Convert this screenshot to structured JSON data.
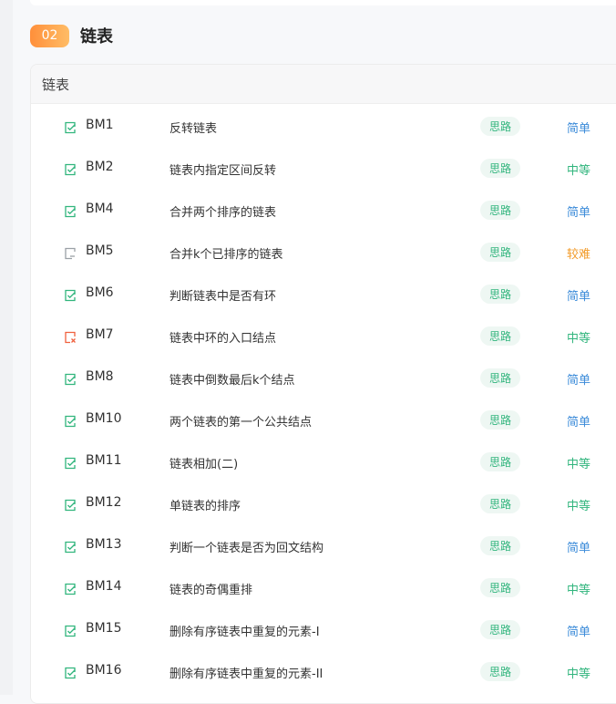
{
  "section": {
    "badge": "02",
    "title": "链表"
  },
  "card": {
    "header": "链表"
  },
  "problems": [
    {
      "code": "BM1",
      "title": "反转链表",
      "tag": "思路",
      "difficulty": "简单",
      "status": "done"
    },
    {
      "code": "BM2",
      "title": "链表内指定区间反转",
      "tag": "思路",
      "difficulty": "中等",
      "status": "done"
    },
    {
      "code": "BM4",
      "title": "合并两个排序的链表",
      "tag": "思路",
      "difficulty": "简单",
      "status": "done"
    },
    {
      "code": "BM5",
      "title": "合并k个已排序的链表",
      "tag": "思路",
      "difficulty": "较难",
      "status": "todo"
    },
    {
      "code": "BM6",
      "title": "判断链表中是否有环",
      "tag": "思路",
      "difficulty": "简单",
      "status": "done"
    },
    {
      "code": "BM7",
      "title": "链表中环的入口结点",
      "tag": "思路",
      "difficulty": "中等",
      "status": "wrong"
    },
    {
      "code": "BM8",
      "title": "链表中倒数最后k个结点",
      "tag": "思路",
      "difficulty": "简单",
      "status": "done"
    },
    {
      "code": "BM10",
      "title": "两个链表的第一个公共结点",
      "tag": "思路",
      "difficulty": "简单",
      "status": "done"
    },
    {
      "code": "BM11",
      "title": "链表相加(二)",
      "tag": "思路",
      "difficulty": "中等",
      "status": "done"
    },
    {
      "code": "BM12",
      "title": "单链表的排序",
      "tag": "思路",
      "difficulty": "中等",
      "status": "done"
    },
    {
      "code": "BM13",
      "title": "判断一个链表是否为回文结构",
      "tag": "思路",
      "difficulty": "简单",
      "status": "done"
    },
    {
      "code": "BM14",
      "title": "链表的奇偶重排",
      "tag": "思路",
      "difficulty": "中等",
      "status": "done"
    },
    {
      "code": "BM15",
      "title": "删除有序链表中重复的元素-I",
      "tag": "思路",
      "difficulty": "简单",
      "status": "done"
    },
    {
      "code": "BM16",
      "title": "删除有序链表中重复的元素-II",
      "tag": "思路",
      "difficulty": "中等",
      "status": "done"
    }
  ],
  "colors": {
    "done": "#31b57d",
    "todo": "#9aa0a6",
    "wrong": "#f0603d",
    "easy": "#3b8bd9",
    "medium": "#31b57d",
    "hard": "#f29a27",
    "accent": "#ff8f3a"
  }
}
